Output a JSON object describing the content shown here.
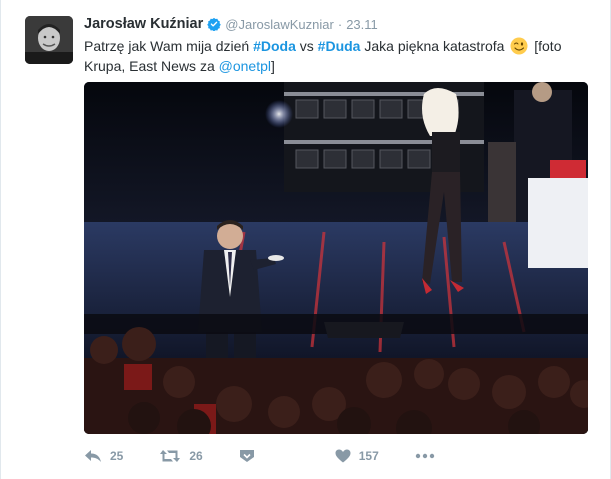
{
  "tweet": {
    "author": {
      "fullname": "Jarosław Kuźniar",
      "handle": "@JaroslawKuzniar",
      "verified": true,
      "verified_color": "#1da1f2"
    },
    "separator": "·",
    "timestamp": "23.11",
    "text_parts": [
      {
        "type": "text",
        "value": "Patrzę jak Wam mija dzień "
      },
      {
        "type": "hashtag",
        "value": "#Doda"
      },
      {
        "type": "text",
        "value": " vs "
      },
      {
        "type": "hashtag",
        "value": "#Duda"
      },
      {
        "type": "text",
        "value": " Jaka piękna katastrofa "
      },
      {
        "type": "emoji",
        "value": "winking-face"
      },
      {
        "type": "text",
        "value": " [foto Krupa, East News za "
      },
      {
        "type": "mention",
        "value": "@onetpl"
      },
      {
        "type": "text",
        "value": "]"
      }
    ],
    "link_color": "#1b95e0",
    "actions": {
      "reply": {
        "icon": "reply-icon",
        "count": "25"
      },
      "retweet": {
        "icon": "retweet-icon",
        "count": "26"
      },
      "moments": {
        "icon": "moments-icon"
      },
      "like": {
        "icon": "heart-icon",
        "count": "157"
      },
      "more": {
        "icon": "more-dots-icon"
      }
    }
  }
}
